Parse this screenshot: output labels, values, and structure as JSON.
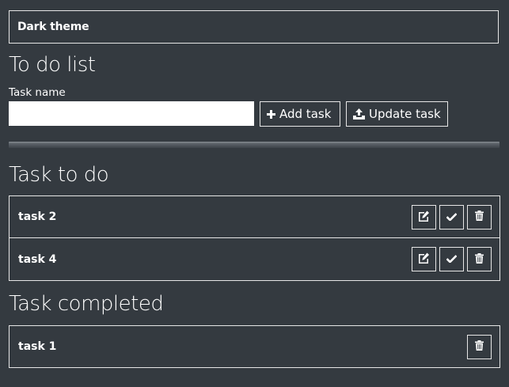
{
  "header": {
    "theme_label": "Dark theme"
  },
  "form": {
    "title": "To do list",
    "task_label": "Task name",
    "task_value": "",
    "add_label": "Add task",
    "update_label": "Update task"
  },
  "todo": {
    "title": "Task to do",
    "tasks": [
      {
        "name": "task 2"
      },
      {
        "name": "task 4"
      }
    ]
  },
  "completed": {
    "title": "Task completed",
    "tasks": [
      {
        "name": "task 1"
      }
    ]
  },
  "icons": {
    "add": "plus-icon",
    "update": "upload-icon",
    "edit": "edit-icon",
    "complete": "check-icon",
    "delete": "trash-icon"
  },
  "colors": {
    "background": "#343a40",
    "foreground": "#ffffff",
    "border": "#e6e6e6"
  }
}
